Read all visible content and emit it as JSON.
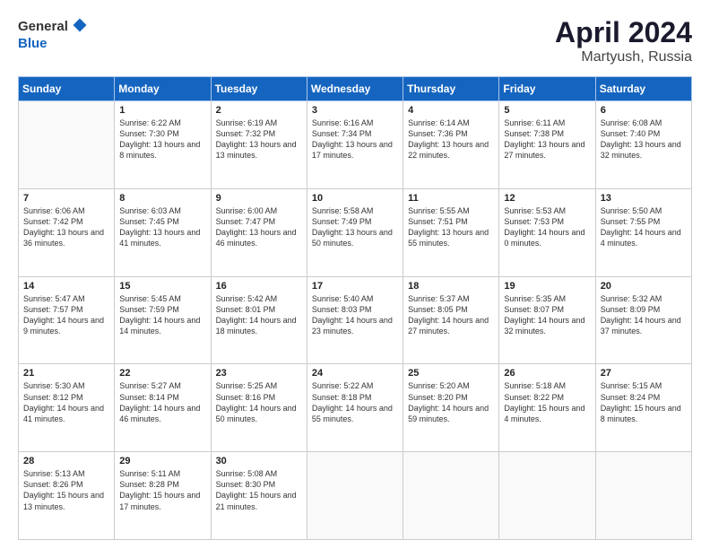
{
  "header": {
    "logo_general": "General",
    "logo_blue": "Blue",
    "title": "April 2024",
    "location": "Martyush, Russia"
  },
  "weekdays": [
    "Sunday",
    "Monday",
    "Tuesday",
    "Wednesday",
    "Thursday",
    "Friday",
    "Saturday"
  ],
  "weeks": [
    [
      {
        "day": "",
        "sunrise": "",
        "sunset": "",
        "daylight": ""
      },
      {
        "day": "1",
        "sunrise": "Sunrise: 6:22 AM",
        "sunset": "Sunset: 7:30 PM",
        "daylight": "Daylight: 13 hours and 8 minutes."
      },
      {
        "day": "2",
        "sunrise": "Sunrise: 6:19 AM",
        "sunset": "Sunset: 7:32 PM",
        "daylight": "Daylight: 13 hours and 13 minutes."
      },
      {
        "day": "3",
        "sunrise": "Sunrise: 6:16 AM",
        "sunset": "Sunset: 7:34 PM",
        "daylight": "Daylight: 13 hours and 17 minutes."
      },
      {
        "day": "4",
        "sunrise": "Sunrise: 6:14 AM",
        "sunset": "Sunset: 7:36 PM",
        "daylight": "Daylight: 13 hours and 22 minutes."
      },
      {
        "day": "5",
        "sunrise": "Sunrise: 6:11 AM",
        "sunset": "Sunset: 7:38 PM",
        "daylight": "Daylight: 13 hours and 27 minutes."
      },
      {
        "day": "6",
        "sunrise": "Sunrise: 6:08 AM",
        "sunset": "Sunset: 7:40 PM",
        "daylight": "Daylight: 13 hours and 32 minutes."
      }
    ],
    [
      {
        "day": "7",
        "sunrise": "Sunrise: 6:06 AM",
        "sunset": "Sunset: 7:42 PM",
        "daylight": "Daylight: 13 hours and 36 minutes."
      },
      {
        "day": "8",
        "sunrise": "Sunrise: 6:03 AM",
        "sunset": "Sunset: 7:45 PM",
        "daylight": "Daylight: 13 hours and 41 minutes."
      },
      {
        "day": "9",
        "sunrise": "Sunrise: 6:00 AM",
        "sunset": "Sunset: 7:47 PM",
        "daylight": "Daylight: 13 hours and 46 minutes."
      },
      {
        "day": "10",
        "sunrise": "Sunrise: 5:58 AM",
        "sunset": "Sunset: 7:49 PM",
        "daylight": "Daylight: 13 hours and 50 minutes."
      },
      {
        "day": "11",
        "sunrise": "Sunrise: 5:55 AM",
        "sunset": "Sunset: 7:51 PM",
        "daylight": "Daylight: 13 hours and 55 minutes."
      },
      {
        "day": "12",
        "sunrise": "Sunrise: 5:53 AM",
        "sunset": "Sunset: 7:53 PM",
        "daylight": "Daylight: 14 hours and 0 minutes."
      },
      {
        "day": "13",
        "sunrise": "Sunrise: 5:50 AM",
        "sunset": "Sunset: 7:55 PM",
        "daylight": "Daylight: 14 hours and 4 minutes."
      }
    ],
    [
      {
        "day": "14",
        "sunrise": "Sunrise: 5:47 AM",
        "sunset": "Sunset: 7:57 PM",
        "daylight": "Daylight: 14 hours and 9 minutes."
      },
      {
        "day": "15",
        "sunrise": "Sunrise: 5:45 AM",
        "sunset": "Sunset: 7:59 PM",
        "daylight": "Daylight: 14 hours and 14 minutes."
      },
      {
        "day": "16",
        "sunrise": "Sunrise: 5:42 AM",
        "sunset": "Sunset: 8:01 PM",
        "daylight": "Daylight: 14 hours and 18 minutes."
      },
      {
        "day": "17",
        "sunrise": "Sunrise: 5:40 AM",
        "sunset": "Sunset: 8:03 PM",
        "daylight": "Daylight: 14 hours and 23 minutes."
      },
      {
        "day": "18",
        "sunrise": "Sunrise: 5:37 AM",
        "sunset": "Sunset: 8:05 PM",
        "daylight": "Daylight: 14 hours and 27 minutes."
      },
      {
        "day": "19",
        "sunrise": "Sunrise: 5:35 AM",
        "sunset": "Sunset: 8:07 PM",
        "daylight": "Daylight: 14 hours and 32 minutes."
      },
      {
        "day": "20",
        "sunrise": "Sunrise: 5:32 AM",
        "sunset": "Sunset: 8:09 PM",
        "daylight": "Daylight: 14 hours and 37 minutes."
      }
    ],
    [
      {
        "day": "21",
        "sunrise": "Sunrise: 5:30 AM",
        "sunset": "Sunset: 8:12 PM",
        "daylight": "Daylight: 14 hours and 41 minutes."
      },
      {
        "day": "22",
        "sunrise": "Sunrise: 5:27 AM",
        "sunset": "Sunset: 8:14 PM",
        "daylight": "Daylight: 14 hours and 46 minutes."
      },
      {
        "day": "23",
        "sunrise": "Sunrise: 5:25 AM",
        "sunset": "Sunset: 8:16 PM",
        "daylight": "Daylight: 14 hours and 50 minutes."
      },
      {
        "day": "24",
        "sunrise": "Sunrise: 5:22 AM",
        "sunset": "Sunset: 8:18 PM",
        "daylight": "Daylight: 14 hours and 55 minutes."
      },
      {
        "day": "25",
        "sunrise": "Sunrise: 5:20 AM",
        "sunset": "Sunset: 8:20 PM",
        "daylight": "Daylight: 14 hours and 59 minutes."
      },
      {
        "day": "26",
        "sunrise": "Sunrise: 5:18 AM",
        "sunset": "Sunset: 8:22 PM",
        "daylight": "Daylight: 15 hours and 4 minutes."
      },
      {
        "day": "27",
        "sunrise": "Sunrise: 5:15 AM",
        "sunset": "Sunset: 8:24 PM",
        "daylight": "Daylight: 15 hours and 8 minutes."
      }
    ],
    [
      {
        "day": "28",
        "sunrise": "Sunrise: 5:13 AM",
        "sunset": "Sunset: 8:26 PM",
        "daylight": "Daylight: 15 hours and 13 minutes."
      },
      {
        "day": "29",
        "sunrise": "Sunrise: 5:11 AM",
        "sunset": "Sunset: 8:28 PM",
        "daylight": "Daylight: 15 hours and 17 minutes."
      },
      {
        "day": "30",
        "sunrise": "Sunrise: 5:08 AM",
        "sunset": "Sunset: 8:30 PM",
        "daylight": "Daylight: 15 hours and 21 minutes."
      },
      {
        "day": "",
        "sunrise": "",
        "sunset": "",
        "daylight": ""
      },
      {
        "day": "",
        "sunrise": "",
        "sunset": "",
        "daylight": ""
      },
      {
        "day": "",
        "sunrise": "",
        "sunset": "",
        "daylight": ""
      },
      {
        "day": "",
        "sunrise": "",
        "sunset": "",
        "daylight": ""
      }
    ]
  ]
}
